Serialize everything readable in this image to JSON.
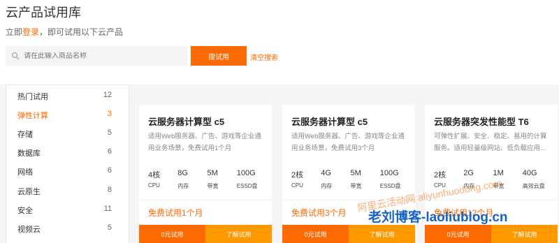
{
  "header": {
    "title": "云产品试用库",
    "login_prefix": "立即",
    "login_link": "登录",
    "login_suffix": "，即可试用以下云产品"
  },
  "search": {
    "placeholder": "请在此输入商品名称",
    "button": "搜试用",
    "clear": "清空搜索"
  },
  "sidebar": {
    "items": [
      {
        "label": "热门试用",
        "count": "12"
      },
      {
        "label": "弹性计算",
        "count": "3",
        "active": true
      },
      {
        "label": "存储",
        "count": "5"
      },
      {
        "label": "数据库",
        "count": "6"
      },
      {
        "label": "网络",
        "count": "6"
      },
      {
        "label": "云原生",
        "count": "8"
      },
      {
        "label": "安全",
        "count": "11"
      },
      {
        "label": "视频云",
        "count": "5"
      }
    ]
  },
  "cards": [
    {
      "name": "云服务器计算型 c5",
      "desc": "适用Web服务器、广告、游戏等企业通用业务场景，免费试用1个月",
      "specs": [
        {
          "value": "4核",
          "unit": "CPU"
        },
        {
          "value": "8G",
          "unit": "内存"
        },
        {
          "value": "5M",
          "unit": "带宽"
        },
        {
          "value": "100G",
          "unit": "ESSD盘"
        }
      ],
      "trial": "免费试用1个月",
      "btn_try": "0元试用",
      "btn_more": "了解试用"
    },
    {
      "name": "云服务器计算型 c5",
      "desc": "适用Web服务器、广告、游戏等企业通用业务场景，免费试用3个月",
      "specs": [
        {
          "value": "2核",
          "unit": "CPU"
        },
        {
          "value": "4G",
          "unit": "内存"
        },
        {
          "value": "5M",
          "unit": "带宽"
        },
        {
          "value": "100G",
          "unit": "ESSD盘"
        }
      ],
      "trial": "免费试用3个月",
      "btn_try": "0元试用",
      "btn_more": "了解试用"
    },
    {
      "name": "云服务器突发性能型 T6",
      "desc": "可弹性扩展、安全、稳定、易用的计算服务。适用轻量级网站、低负载应用...",
      "specs": [
        {
          "value": "2核",
          "unit": "CPU"
        },
        {
          "value": "2G",
          "unit": "内存"
        },
        {
          "value": "1M",
          "unit": "带宽"
        },
        {
          "value": "40G",
          "unit": "高效云盘"
        }
      ],
      "trial": "免费试用12个月",
      "btn_try": "0元试用",
      "btn_more": "了解试用"
    }
  ],
  "watermark": {
    "line1": "阿里云活动网 aliyunhuodong.com",
    "line2": "老刘博客-laoliublog.cn"
  },
  "colors": {
    "accent": "#ff6a00",
    "secondary": "#ff9900",
    "watermark_blue": "#1565c0"
  }
}
